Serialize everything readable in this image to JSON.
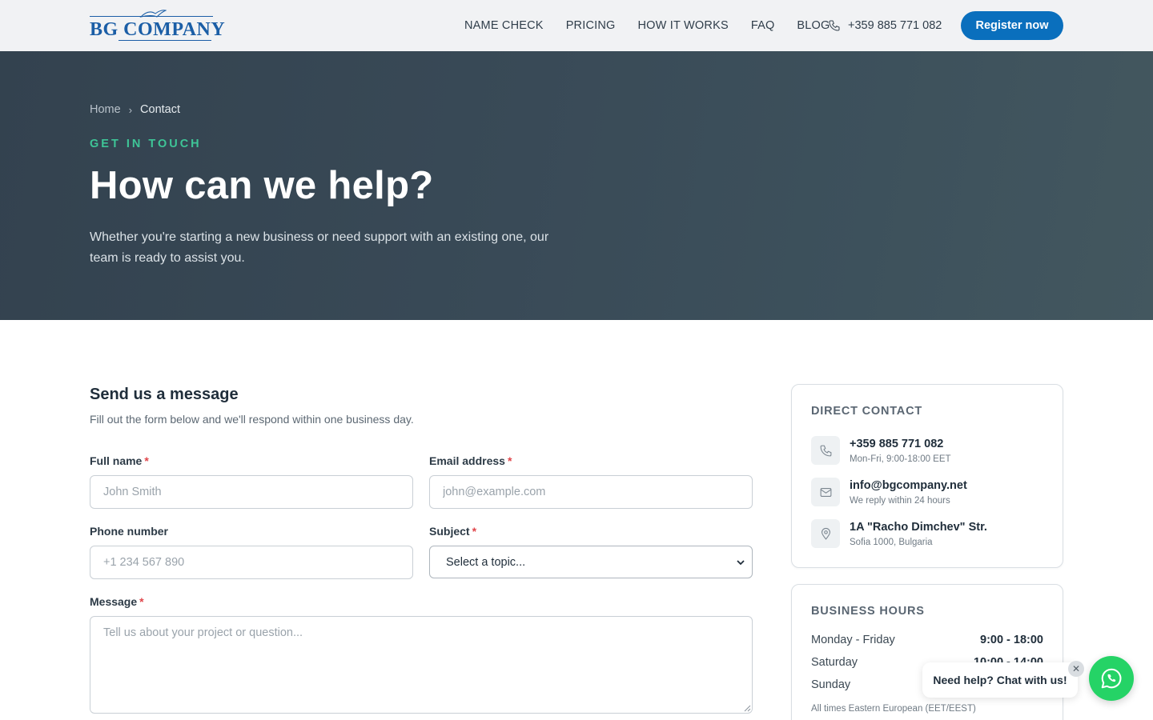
{
  "header": {
    "logo_text": "BG COMPANY",
    "nav": [
      "NAME CHECK",
      "PRICING",
      "HOW IT WORKS",
      "FAQ",
      "BLOG"
    ],
    "phone": "+359 885 771 082",
    "register_label": "Register now"
  },
  "hero": {
    "breadcrumb_home": "Home",
    "breadcrumb_sep": "›",
    "breadcrumb_current": "Contact",
    "eyebrow": "GET IN TOUCH",
    "title": "How can we help?",
    "subtitle": "Whether you're starting a new business or need support with an existing one, our team is ready to assist you."
  },
  "form": {
    "title": "Send us a message",
    "subtitle": "Fill out the form below and we'll respond within one business day.",
    "required_mark": "*",
    "full_name": {
      "label": "Full name",
      "placeholder": "John Smith",
      "value": ""
    },
    "email": {
      "label": "Email address",
      "placeholder": "john@example.com",
      "value": ""
    },
    "phone": {
      "label": "Phone number",
      "placeholder": "+1 234 567 890",
      "value": ""
    },
    "subject": {
      "label": "Subject",
      "selected": "Select a topic..."
    },
    "message": {
      "label": "Message",
      "placeholder": "Tell us about your project or question...",
      "value": ""
    }
  },
  "direct_contact": {
    "heading": "DIRECT CONTACT",
    "items": [
      {
        "icon": "phone-icon",
        "main": "+359 885 771 082",
        "meta": "Mon-Fri, 9:00-18:00 EET"
      },
      {
        "icon": "mail-icon",
        "main": "info@bgcompany.net",
        "meta": "We reply within 24 hours"
      },
      {
        "icon": "location-pin-icon",
        "main": "1A \"Racho Dimchev\" Str.",
        "meta": "Sofia 1000, Bulgaria"
      }
    ]
  },
  "business_hours": {
    "heading": "BUSINESS HOURS",
    "rows": [
      {
        "day": "Monday - Friday",
        "time": "9:00 - 18:00"
      },
      {
        "day": "Saturday",
        "time": "10:00 - 14:00"
      },
      {
        "day": "Sunday",
        "time": ""
      }
    ],
    "note": "All times Eastern European (EET/EEST)"
  },
  "chat": {
    "bubble_text": "Need help? Chat with us!",
    "close_glyph": "✕"
  },
  "colors": {
    "brand_blue": "#0a6fbd",
    "accent_green": "#3ec597",
    "whatsapp_green": "#25d366",
    "required_red": "#e0464b"
  }
}
